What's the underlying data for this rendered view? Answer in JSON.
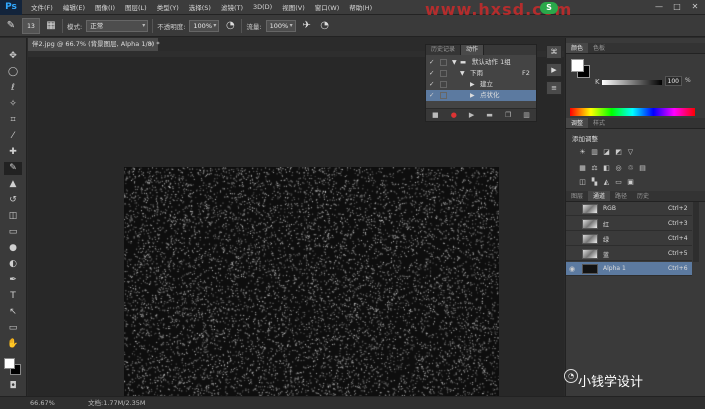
{
  "menu": {
    "logo": "Ps",
    "items": [
      "文件(F)",
      "编辑(E)",
      "图像(I)",
      "图层(L)",
      "类型(Y)",
      "选择(S)",
      "滤镜(T)",
      "3D(D)",
      "视图(V)",
      "窗口(W)",
      "帮助(H)"
    ],
    "watermark": "www.hxsd.com"
  },
  "options": {
    "brush_size": "13",
    "mode_label": "模式:",
    "mode_value": "正常",
    "opacity_label": "不透明度:",
    "opacity_value": "100%",
    "flow_label": "流量:",
    "flow_value": "100%"
  },
  "document": {
    "tab_title": "伴2.jpg @ 66.7% (背景图层, Alpha 1/8) *",
    "zoom": "66.67%",
    "info": "文档:1.77M/2.35M"
  },
  "actions_panel": {
    "tabs": [
      "历史记录",
      "动作"
    ],
    "active_tab": 1,
    "rows": [
      {
        "label": "默认动作 1组",
        "key": ""
      },
      {
        "label": "下雨",
        "key": "F2"
      },
      {
        "label": "建立",
        "key": ""
      },
      {
        "label": "点状化",
        "key": ""
      }
    ]
  },
  "color_panel": {
    "tabs": [
      "颜色",
      "色板"
    ],
    "channel": "K",
    "value": "100",
    "unit": "%"
  },
  "adjust_panel": {
    "tabs": [
      "调整",
      "样式"
    ],
    "title": "添加调整"
  },
  "channels_panel": {
    "tabs": [
      "图层",
      "通道",
      "路径",
      "历史"
    ],
    "active_tab": 1,
    "rows": [
      {
        "name": "RGB",
        "key": "Ctrl+2"
      },
      {
        "name": "红",
        "key": "Ctrl+3"
      },
      {
        "name": "绿",
        "key": "Ctrl+4"
      },
      {
        "name": "蓝",
        "key": "Ctrl+5"
      },
      {
        "name": "Alpha 1",
        "key": "Ctrl+6"
      }
    ]
  },
  "footer_watermark": "小钱学设计",
  "colors": {
    "selection": "#5c7aa0",
    "foreground": "#ffffff",
    "background": "#000000"
  }
}
